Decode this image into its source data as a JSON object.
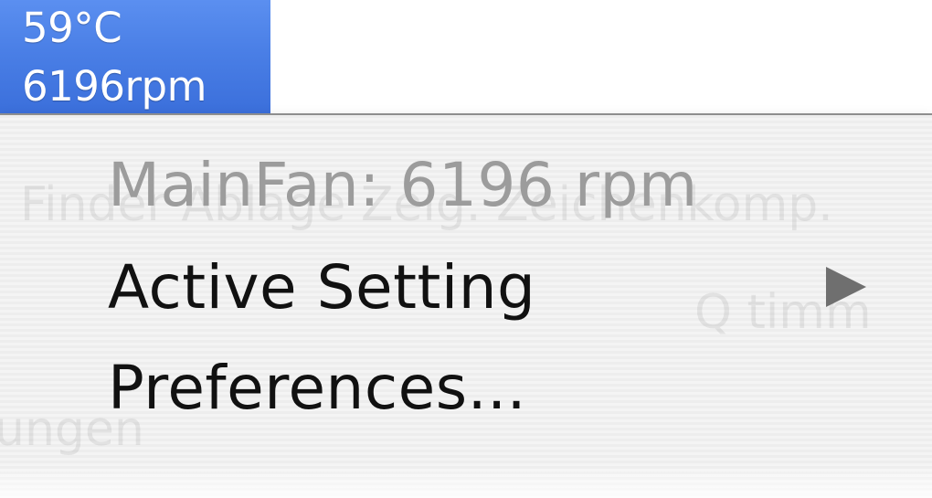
{
  "status_item": {
    "temperature": "59°C",
    "fan_speed": "6196rpm",
    "highlight_color": "#4a7fe6"
  },
  "menu": {
    "items": [
      {
        "label": "MainFan: 6196 rpm",
        "enabled": false
      },
      {
        "label": "Active Setting",
        "enabled": true,
        "has_submenu": true,
        "icon": "submenu-arrow-icon"
      },
      {
        "label": "Preferences...",
        "enabled": true
      }
    ]
  },
  "background_ghost_text": {
    "line1": "Finder  Ablage  Zeig.  Zeichenkomp.",
    "line2": "Q timm",
    "line3": "ungen"
  }
}
